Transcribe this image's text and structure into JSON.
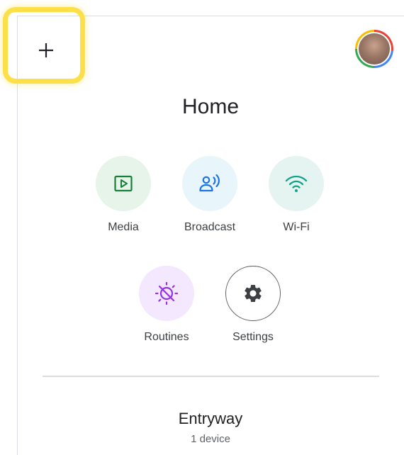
{
  "header": {
    "add_icon": "plus-icon",
    "avatar_icon": "profile-avatar"
  },
  "home": {
    "title": "Home"
  },
  "actions": [
    {
      "label": "Media",
      "icon": "media-play-icon",
      "bg": "#e6f4ea",
      "fg": "#188038"
    },
    {
      "label": "Broadcast",
      "icon": "broadcast-icon",
      "bg": "#e8f6fb",
      "fg": "#1a73e8"
    },
    {
      "label": "Wi-Fi",
      "icon": "wifi-icon",
      "bg": "#e6f4f1",
      "fg": "#12a38b"
    },
    {
      "label": "Routines",
      "icon": "routines-icon",
      "bg": "#f3e8fd",
      "fg": "#9334e6"
    },
    {
      "label": "Settings",
      "icon": "gear-icon",
      "bg": "#ffffff",
      "fg": "#3c4043"
    }
  ],
  "room": {
    "name": "Entryway",
    "subtitle": "1 device"
  },
  "colors": {
    "highlight": "#fde047",
    "divider": "#dadce0",
    "text_primary": "#202124"
  }
}
